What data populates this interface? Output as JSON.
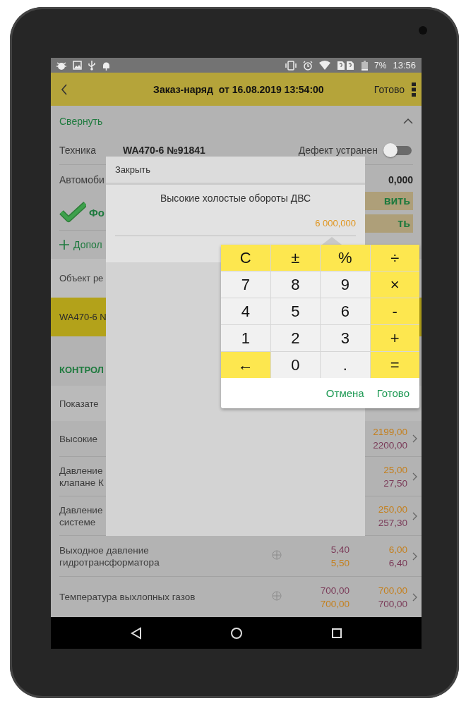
{
  "status_bar": {
    "battery": "7%",
    "time": "13:56"
  },
  "app_bar": {
    "title": "Заказ-наряд  от 16.08.2019 13:54:00",
    "done": "Готово"
  },
  "collapse": {
    "label": "Свернуть",
    "expanded": true
  },
  "equipment": {
    "label": "Техника",
    "value": "WA470-6 №91841",
    "toggle_label": "Дефект устранен",
    "on": false
  },
  "vehicle": {
    "label": "Автомоби",
    "value": "0,000"
  },
  "status_row": {
    "label": "Фо",
    "buttons": [
      "вить",
      "ть"
    ]
  },
  "add_link": "Допол",
  "object": {
    "label": "Объект ре",
    "value": "WA470-6 N"
  },
  "section_title": "КОНТРОЛ",
  "table": {
    "header": "Показате",
    "rows": [
      {
        "name": "Высокие",
        "add_icon": false,
        "v1": [],
        "v2": [
          {
            "text": "2199,00",
            "color": "#c47f1c"
          },
          {
            "text": "2200,00",
            "color": "#7a3a58"
          }
        ]
      },
      {
        "name": "Давление\nклапане К",
        "add_icon": false,
        "v1": [],
        "v2": [
          {
            "text": "25,00",
            "color": "#c47f1c"
          },
          {
            "text": "27,50",
            "color": "#7a3a58"
          }
        ]
      },
      {
        "name": "Давление\nсистеме",
        "add_icon": false,
        "v1": [],
        "v2": [
          {
            "text": "250,00",
            "color": "#c47f1c"
          },
          {
            "text": "257,30",
            "color": "#7a3a58"
          }
        ]
      },
      {
        "name": "Выходное давление\nгидротрансформатора",
        "add_icon": true,
        "v1": [
          {
            "text": "5,40",
            "color": "#7a3a58"
          },
          {
            "text": "5,50",
            "color": "#c47f1c"
          }
        ],
        "v2": [
          {
            "text": "6,00",
            "color": "#c47f1c"
          },
          {
            "text": "6,40",
            "color": "#7a3a58"
          }
        ]
      },
      {
        "name": "Температура выхлопных газов",
        "add_icon": true,
        "v1": [
          {
            "text": "700,00",
            "color": "#7a3a58"
          },
          {
            "text": "700,00",
            "color": "#c47f1c"
          }
        ],
        "v2": [
          {
            "text": "700,00",
            "color": "#c47f1c"
          },
          {
            "text": "700,00",
            "color": "#7a3a58"
          }
        ]
      }
    ]
  },
  "dialog": {
    "close": "Закрыть",
    "title": "Высокие холостые обороты ДВС",
    "value": "6 000,000"
  },
  "calculator": {
    "keys": [
      [
        {
          "label": "C",
          "kind": "op"
        },
        {
          "label": "±",
          "kind": "op"
        },
        {
          "label": "%",
          "kind": "op"
        },
        {
          "label": "÷",
          "kind": "op"
        }
      ],
      [
        {
          "label": "7",
          "kind": "digit"
        },
        {
          "label": "8",
          "kind": "digit"
        },
        {
          "label": "9",
          "kind": "digit"
        },
        {
          "label": "×",
          "kind": "op"
        }
      ],
      [
        {
          "label": "4",
          "kind": "digit"
        },
        {
          "label": "5",
          "kind": "digit"
        },
        {
          "label": "6",
          "kind": "digit"
        },
        {
          "label": "-",
          "kind": "op"
        }
      ],
      [
        {
          "label": "1",
          "kind": "digit"
        },
        {
          "label": "2",
          "kind": "digit"
        },
        {
          "label": "3",
          "kind": "digit"
        },
        {
          "label": "+",
          "kind": "op"
        }
      ],
      [
        {
          "label": "←",
          "kind": "op"
        },
        {
          "label": "0",
          "kind": "digit"
        },
        {
          "label": ".",
          "kind": "digit"
        },
        {
          "label": "=",
          "kind": "op"
        }
      ]
    ],
    "actions": [
      "Отмена",
      "Готово"
    ]
  }
}
